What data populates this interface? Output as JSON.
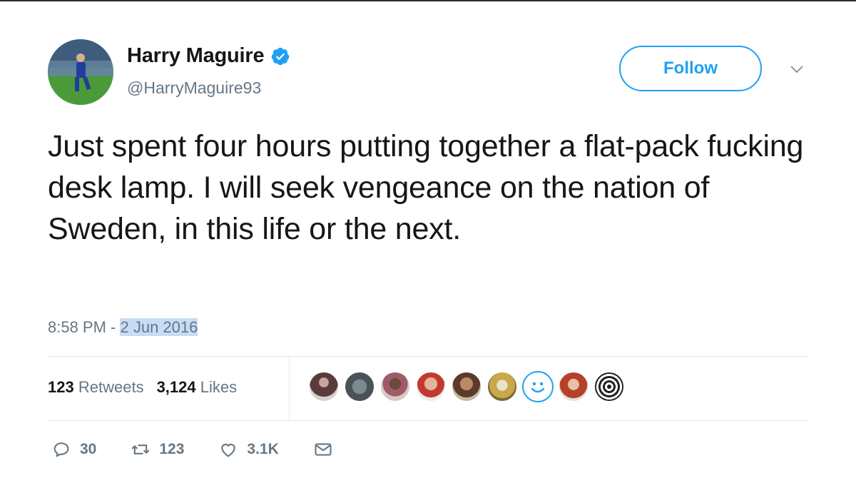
{
  "user": {
    "name": "Harry Maguire",
    "handle": "@HarryMaguire93"
  },
  "follow_label": "Follow",
  "tweet": {
    "text": "Just spent four hours putting together a flat-pack fucking desk lamp. I will seek vengeance on the nation of Sweden, in this life or the next.",
    "time": "8:58 PM - ",
    "date": "2 Jun 2016"
  },
  "stats": {
    "retweets_count": "123",
    "retweets_label": "Retweets",
    "likes_count": "3,124",
    "likes_label": "Likes"
  },
  "actions": {
    "replies": "30",
    "retweets": "123",
    "likes": "3.1K"
  },
  "colors": {
    "accent": "#1da1f2",
    "secondary_text": "#657786",
    "date_highlight": "#c7dcf5"
  },
  "icons": [
    "verified-badge-icon",
    "chevron-down-icon",
    "reply-icon",
    "retweet-icon",
    "like-icon",
    "direct-message-icon"
  ]
}
